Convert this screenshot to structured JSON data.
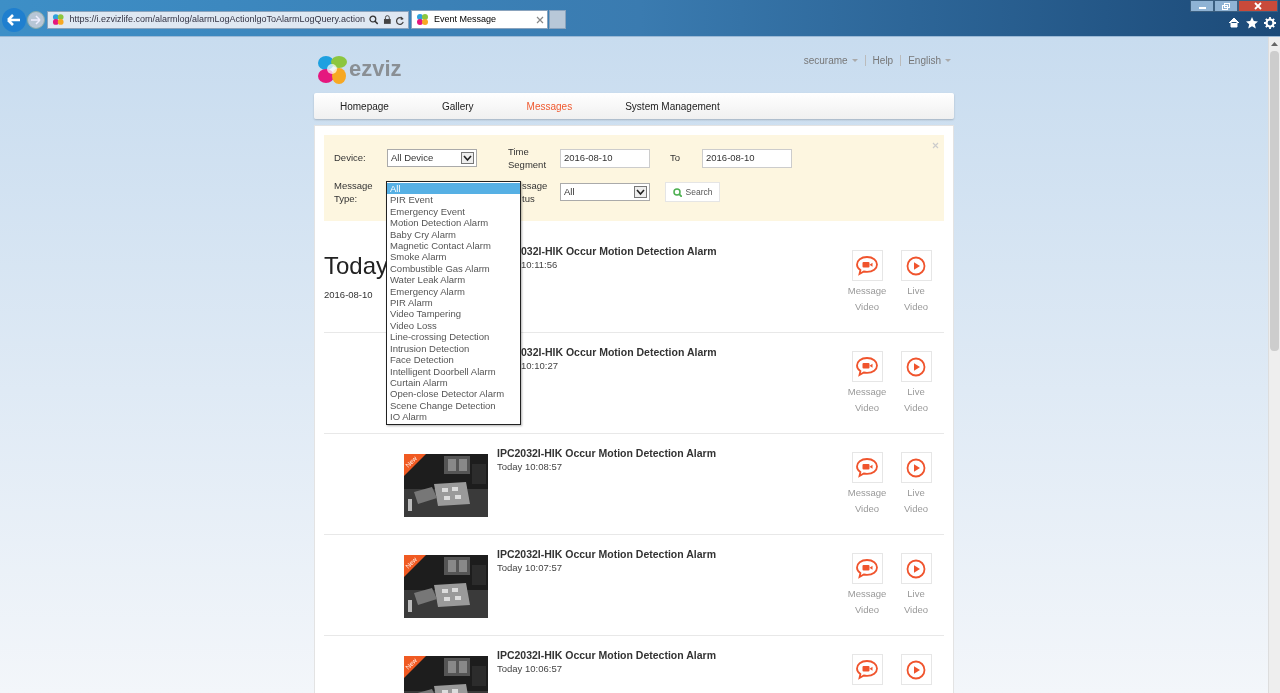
{
  "browser": {
    "url": "https://i.ezvizlife.com/alarmlog/alarmLogActionlgoToAlarmLogQuery.action",
    "tab_title": "Event Message"
  },
  "header": {
    "logo_text": "ezviz",
    "account": "securame",
    "help": "Help",
    "language": "English"
  },
  "nav": [
    {
      "label": "Homepage",
      "selected": false
    },
    {
      "label": "Gallery",
      "selected": false
    },
    {
      "label": "Messages",
      "selected": true
    },
    {
      "label": "System Management",
      "selected": false
    }
  ],
  "filters": {
    "device_label": "Device:",
    "device_value": "All Device",
    "time_label": "Time Segment",
    "from": "2016-08-10",
    "to_label": "To",
    "to": "2016-08-10",
    "type_label": "Message Type:",
    "status_label_lines": [
      "ssage",
      "tus"
    ],
    "status_value": "All",
    "search": "Search"
  },
  "dropdown": [
    {
      "label": "All",
      "selected": true
    },
    {
      "label": "PIR Event",
      "selected": false
    },
    {
      "label": "Emergency Event",
      "selected": false
    },
    {
      "label": "Motion Detection Alarm",
      "selected": false
    },
    {
      "label": "Baby Cry Alarm",
      "selected": false
    },
    {
      "label": "Magnetic Contact Alarm",
      "selected": false
    },
    {
      "label": "Smoke Alarm",
      "selected": false
    },
    {
      "label": "Combustible Gas Alarm",
      "selected": false
    },
    {
      "label": "Water Leak Alarm",
      "selected": false
    },
    {
      "label": "Emergency Alarm",
      "selected": false
    },
    {
      "label": "PIR Alarm",
      "selected": false
    },
    {
      "label": "Video Tampering",
      "selected": false
    },
    {
      "label": "Video Loss",
      "selected": false
    },
    {
      "label": "Line-crossing Detection",
      "selected": false
    },
    {
      "label": "Intrusion Detection",
      "selected": false
    },
    {
      "label": "Face Detection",
      "selected": false
    },
    {
      "label": "Intelligent Doorbell Alarm",
      "selected": false
    },
    {
      "label": "Curtain Alarm",
      "selected": false
    },
    {
      "label": "Open-close Detector Alarm",
      "selected": false
    },
    {
      "label": "Scene Change Detection",
      "selected": false
    },
    {
      "label": "IO Alarm",
      "selected": false
    }
  ],
  "day": {
    "heading": "Today",
    "date": "2016-08-10"
  },
  "events": [
    {
      "kind": "covered",
      "title": "032I-HIK Occur Motion Detection Alarm",
      "time": "10:11:56",
      "actions": [
        {
          "kind": "message_video",
          "label": "Message Video"
        },
        {
          "kind": "live_video",
          "label": "Live Video"
        }
      ]
    },
    {
      "kind": "covered",
      "title": "032I-HIK Occur Motion Detection Alarm",
      "time": "10:10:27",
      "actions": [
        {
          "kind": "message_video",
          "label": "Message Video"
        },
        {
          "kind": "live_video",
          "label": "Live Video"
        }
      ]
    },
    {
      "kind": "thumbnail",
      "badge": "New",
      "title": "IPC2032I-HIK Occur Motion Detection Alarm",
      "time": "Today 10:08:57",
      "actions": [
        {
          "kind": "message_video",
          "label": "Message Video"
        },
        {
          "kind": "live_video",
          "label": "Live Video"
        }
      ]
    },
    {
      "kind": "thumbnail",
      "badge": "New",
      "title": "IPC2032I-HIK Occur Motion Detection Alarm",
      "time": "Today 10:07:57",
      "actions": [
        {
          "kind": "message_video",
          "label": "Message Video"
        },
        {
          "kind": "live_video",
          "label": "Live Video"
        }
      ]
    },
    {
      "kind": "thumbnail",
      "badge": "New",
      "title": "IPC2032I-HIK Occur Motion Detection Alarm",
      "time": "Today 10:06:57",
      "actions": [
        {
          "kind": "message_video"
        },
        {
          "kind": "live_video"
        }
      ]
    }
  ]
}
